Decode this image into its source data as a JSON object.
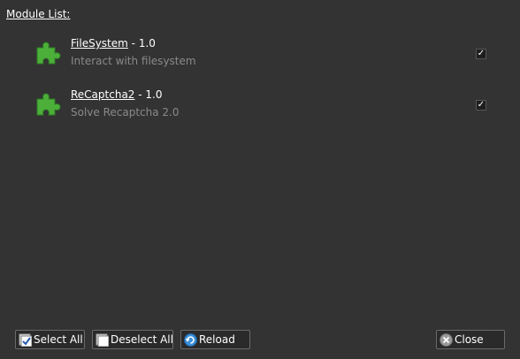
{
  "header": {
    "title": "Module List:"
  },
  "modules": [
    {
      "name": "FileSystem",
      "version": "1.0",
      "description": "Interact with filesystem",
      "checked": true
    },
    {
      "name": "ReCaptcha2",
      "version": "1.0",
      "description": "Solve Recaptcha 2.0",
      "checked": true
    }
  ],
  "buttons": {
    "select_all": "Select All",
    "deselect_all": "Deselect All",
    "reload": "Reload",
    "close": "Close"
  },
  "icons": {
    "module": "puzzle-icon",
    "select_all": "checkbox-checked-icon",
    "deselect_all": "checkbox-empty-icon",
    "reload": "reload-icon",
    "close": "close-icon"
  },
  "colors": {
    "background": "#333333",
    "puzzle_green": "#4caf3a",
    "description_text": "#8a8a8a",
    "reload_blue": "#3a8fd8"
  }
}
